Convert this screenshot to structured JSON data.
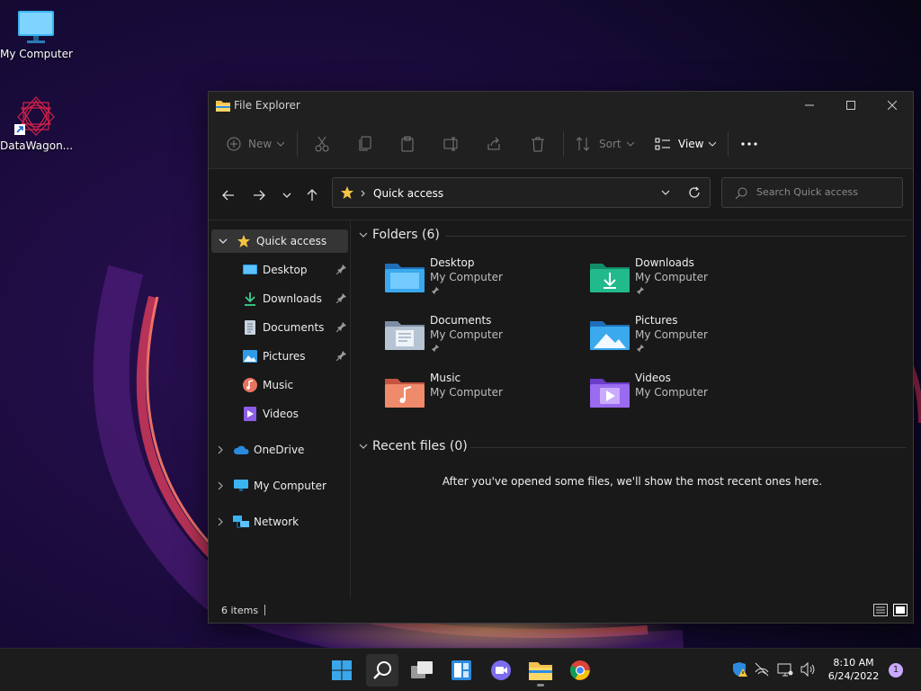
{
  "desktop": {
    "icons": [
      {
        "label": "My Computer"
      },
      {
        "label": "DataWagon..."
      }
    ]
  },
  "window": {
    "title": "File Explorer",
    "toolbar": {
      "new_label": "New",
      "sort_label": "Sort",
      "view_label": "View"
    },
    "address": {
      "location": "Quick access"
    },
    "search": {
      "placeholder": "Search Quick access"
    }
  },
  "navpane": {
    "quick_access": "Quick access",
    "pinned": [
      {
        "label": "Desktop",
        "icon": "desktop-icon"
      },
      {
        "label": "Downloads",
        "icon": "download-icon"
      },
      {
        "label": "Documents",
        "icon": "document-icon"
      },
      {
        "label": "Pictures",
        "icon": "pictures-icon"
      },
      {
        "label": "Music",
        "icon": "music-icon"
      },
      {
        "label": "Videos",
        "icon": "videos-icon"
      }
    ],
    "roots": [
      {
        "label": "OneDrive"
      },
      {
        "label": "My Computer"
      },
      {
        "label": "Network"
      }
    ]
  },
  "content": {
    "folders_heading": "Folders (6)",
    "folders": [
      {
        "name": "Desktop",
        "location": "My Computer",
        "pinned": true
      },
      {
        "name": "Downloads",
        "location": "My Computer",
        "pinned": true
      },
      {
        "name": "Documents",
        "location": "My Computer",
        "pinned": true
      },
      {
        "name": "Pictures",
        "location": "My Computer",
        "pinned": true
      },
      {
        "name": "Music",
        "location": "My Computer",
        "pinned": false
      },
      {
        "name": "Videos",
        "location": "My Computer",
        "pinned": false
      }
    ],
    "recent_heading": "Recent files (0)",
    "empty_message": "After you've opened some files, we'll show the most recent ones here."
  },
  "statusbar": {
    "item_count": "6 items"
  },
  "taskbar": {
    "time": "8:10 AM",
    "date": "6/24/2022",
    "notifications": "1"
  },
  "colors": {
    "window_bg": "#191919",
    "titlebar_bg": "#202020",
    "accent_blue": "#3ba7ea",
    "star": "#f6c343"
  }
}
